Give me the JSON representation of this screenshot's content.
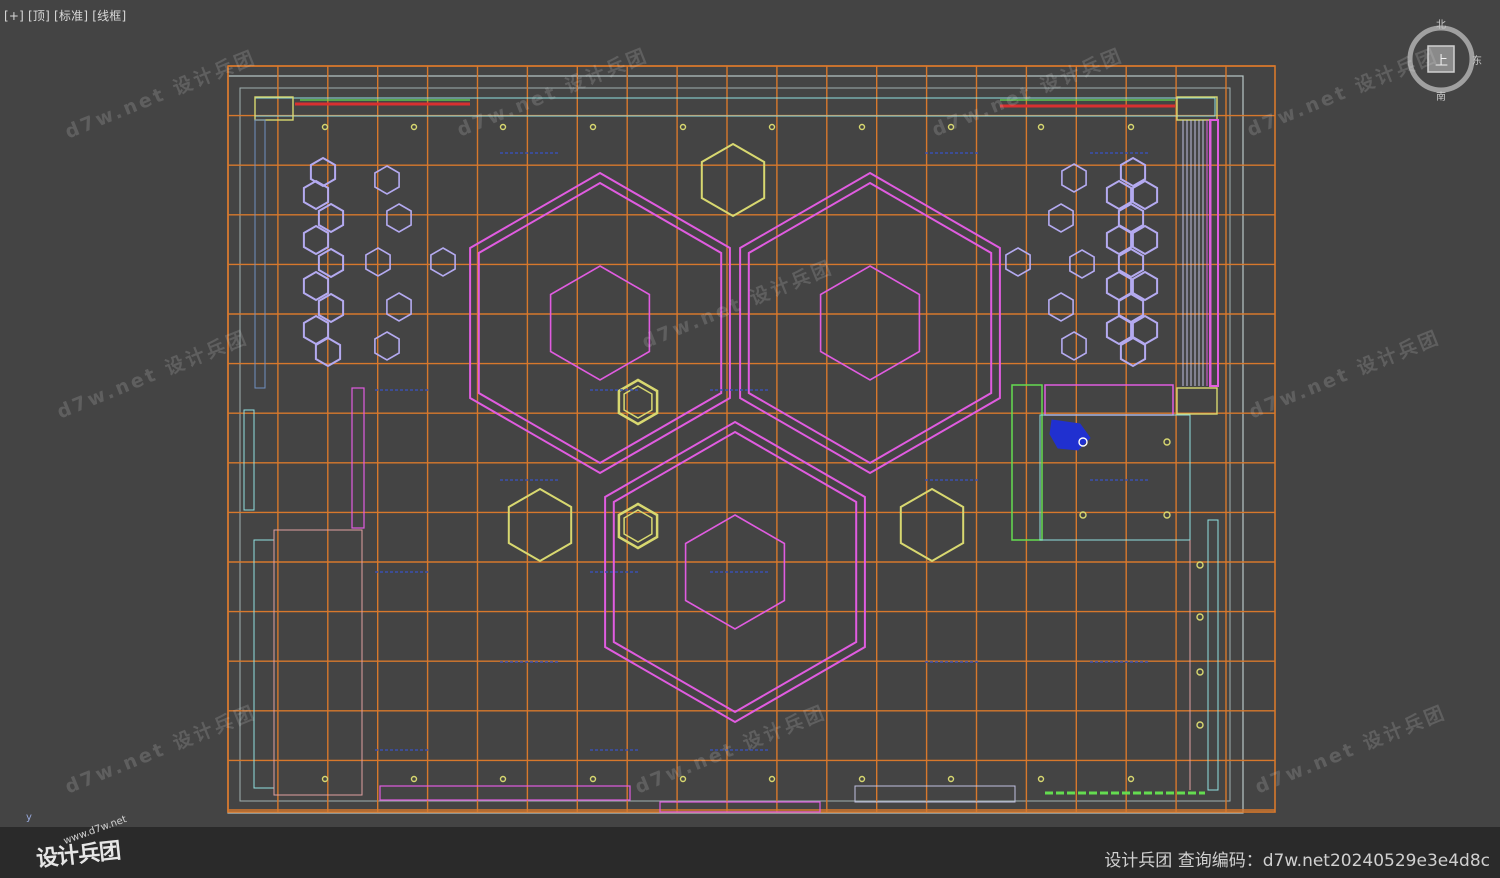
{
  "viewport": {
    "label_parts": [
      "[+]",
      "[顶]",
      "[标准]",
      "[线框]"
    ]
  },
  "viewcube": {
    "face": "上",
    "north": "北",
    "south": "南",
    "east": "东"
  },
  "axis": {
    "y": "y"
  },
  "watermark": {
    "text": "d7w.net 设计兵团"
  },
  "footer": {
    "logo_text": "设计兵团",
    "logo_url": "www.d7w.net",
    "code_label": "设计兵团  查询编码：d7w.net20240529e3e4d8c"
  },
  "colors": {
    "grid": "#d7782c",
    "magenta": "#e05ce0",
    "yellow": "#d8d870",
    "lavender": "#b4aaf0",
    "cyan": "#8fe0e0",
    "green": "#64dc50",
    "blue": "#2030d0",
    "red": "#d83030",
    "background": "#444444"
  }
}
